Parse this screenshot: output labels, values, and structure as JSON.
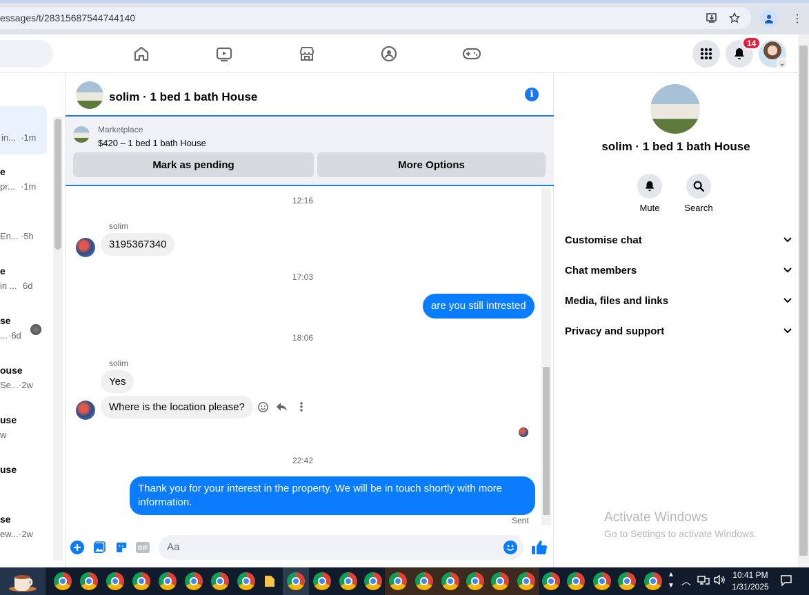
{
  "browser": {
    "url": "essages/t/28315687544744140",
    "icons": [
      "install-app-icon",
      "star-icon",
      "profile-icon",
      "menu-icon"
    ]
  },
  "fbnav": {
    "icons": [
      "home-icon",
      "watch-icon",
      "marketplace-icon",
      "groups-icon",
      "gaming-icon"
    ],
    "notification_count": "14"
  },
  "left_list": {
    "items": [
      {
        "name": "",
        "sub": "in...",
        "time": "·1m",
        "active": true
      },
      {
        "name": "e",
        "sub": "pr...",
        "time": "·1m"
      },
      {
        "name": "",
        "sub": "En...",
        "time": "·5h"
      },
      {
        "name": "e",
        "sub": "in ...",
        "time": "6d"
      },
      {
        "name": "se",
        "sub": "...",
        "time": "·6d"
      },
      {
        "name": "ouse",
        "sub": "Se...",
        "time": "·2w"
      },
      {
        "name": "use",
        "sub": "w",
        "time": ""
      },
      {
        "name": "use",
        "sub": "",
        "time": ""
      },
      {
        "name": "se",
        "sub": "ew...",
        "time": "·2w"
      }
    ]
  },
  "chat": {
    "title": "solim · 1 bed 1 bath House",
    "marketplace": {
      "label": "Marketplace",
      "listing": "$420 – 1 bed 1 bath House",
      "btn_pending": "Mark as pending",
      "btn_more": "More Options"
    },
    "messages": {
      "ts1": "12:16",
      "sender1": "solim",
      "msg1": "3195367340",
      "ts2": "17:03",
      "out1": "are you still intrested",
      "ts3": "18:06",
      "sender2": "solim",
      "msg2": "Yes",
      "msg3": "Where is the location please?",
      "ts4": "22:42",
      "out2": "Thank you for your interest in the property. We will be in touch shortly with more information.",
      "sent_label": "Sent"
    },
    "composer": {
      "placeholder": "Aa"
    },
    "colors": {
      "accent": "#1877f2",
      "outgoing": "#0a7cff",
      "incoming": "#f0f0f0"
    }
  },
  "right_panel": {
    "title": "solim · 1 bed 1 bath House",
    "mute_label": "Mute",
    "search_label": "Search",
    "sections": [
      "Customise chat",
      "Chat members",
      "Media, files and links",
      "Privacy and support"
    ],
    "watermark_title": "Activate Windows",
    "watermark_sub": "Go to Settings to activate Windows."
  },
  "taskbar": {
    "time": "10:41 PM",
    "date": "1/31/2025"
  }
}
